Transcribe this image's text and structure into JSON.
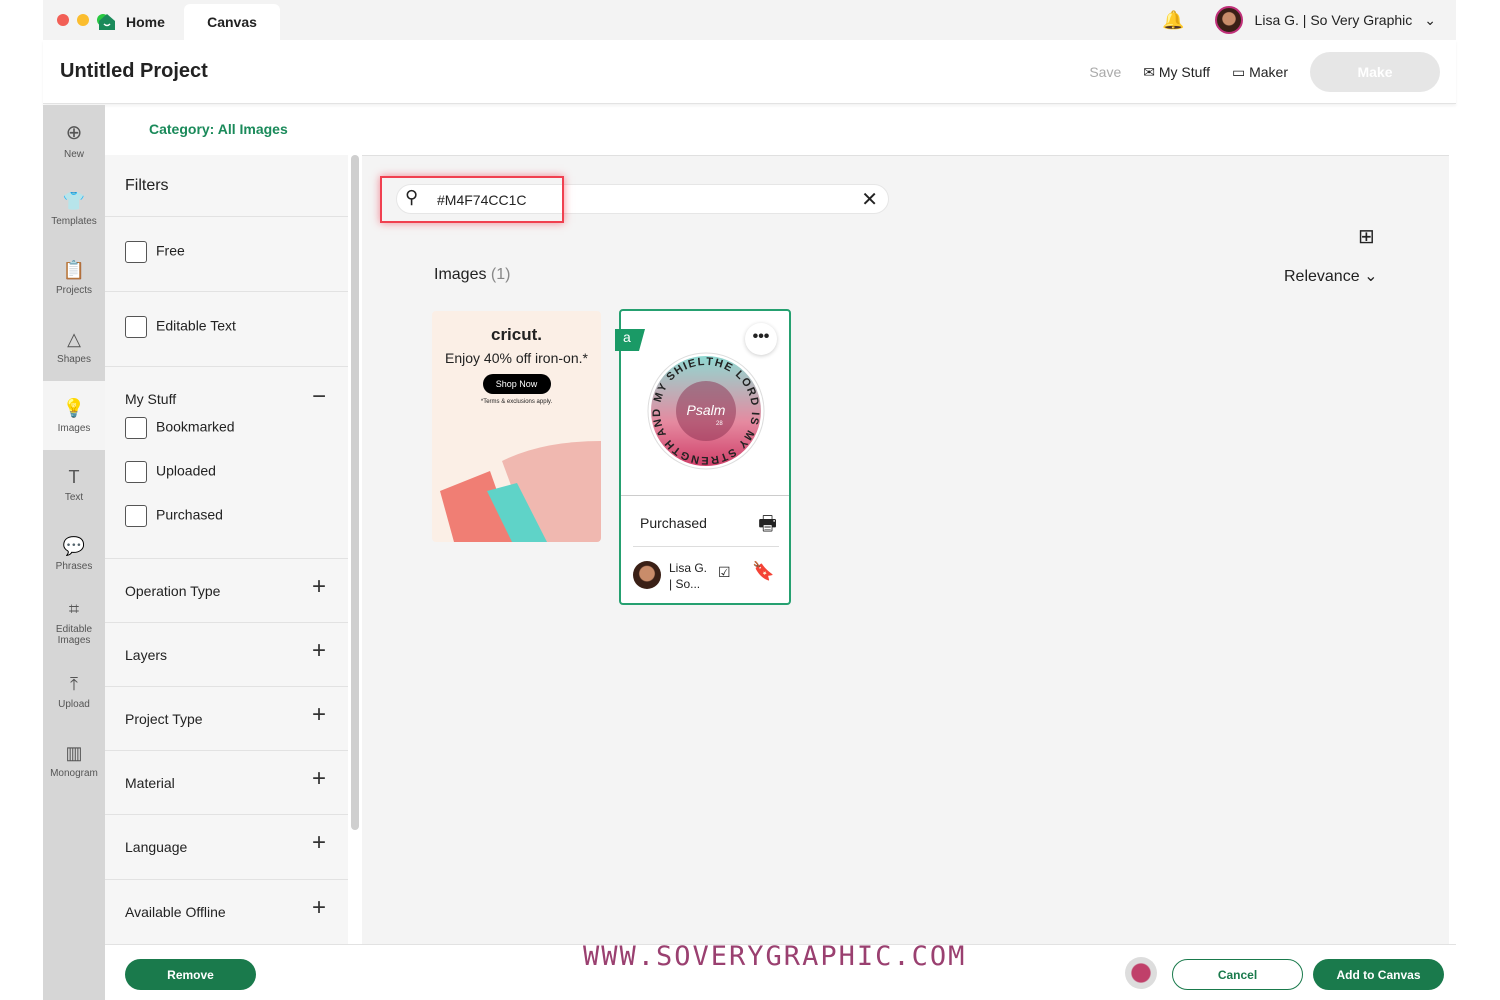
{
  "window": {
    "tabs": [
      {
        "label": "Home"
      },
      {
        "label": "Canvas"
      }
    ],
    "user_name": "Lisa G. | So Very Graphic"
  },
  "header": {
    "title": "Untitled Project",
    "save": "Save",
    "my_stuff": "My Stuff",
    "maker": "Maker",
    "make": "Make"
  },
  "rail": [
    {
      "label": "New",
      "icon": "plus-circle-icon"
    },
    {
      "label": "Templates",
      "icon": "shirt-icon"
    },
    {
      "label": "Projects",
      "icon": "clipboard-icon"
    },
    {
      "label": "Shapes",
      "icon": "shapes-icon"
    },
    {
      "label": "Images",
      "icon": "lightbulb-icon"
    },
    {
      "label": "Text",
      "icon": "text-icon"
    },
    {
      "label": "Phrases",
      "icon": "speech-bubble-icon"
    },
    {
      "label": "Editable Images",
      "icon": "edit-image-icon"
    },
    {
      "label": "Upload",
      "icon": "upload-icon"
    },
    {
      "label": "Monogram",
      "icon": "monogram-icon"
    }
  ],
  "category": "Category: All Images",
  "filters": {
    "title": "Filters",
    "free": "Free",
    "editable_text": "Editable Text",
    "my_stuff": "My Stuff",
    "bookmarked": "Bookmarked",
    "uploaded": "Uploaded",
    "purchased": "Purchased",
    "sections": [
      "Operation Type",
      "Layers",
      "Project Type",
      "Material",
      "Language",
      "Available Offline"
    ]
  },
  "search": {
    "value": "#M4F74CC1C"
  },
  "results": {
    "label": "Images",
    "count": "(1)",
    "sort": "Relevance"
  },
  "ad": {
    "brand": "cricut.",
    "headline": "Enjoy 40% off iron-on.*",
    "button": "Shop Now",
    "fine": "*Terms & exclusions apply."
  },
  "card": {
    "badge": "a",
    "status": "Purchased",
    "author_line1": "Lisa G.",
    "author_line2": "| So...",
    "ring_text": "THE LORD IS MY STRENGTH AND MY SHIELD",
    "center": "Psalm",
    "center_num": "28"
  },
  "watermark": "WWW.SOVERYGRAPHIC.COM",
  "bottom": {
    "remove": "Remove",
    "cancel": "Cancel",
    "add": "Add to Canvas"
  },
  "colors": {
    "accent": "#1a7a4c",
    "green_text": "#1a8a5a",
    "highlight": "#f04050"
  }
}
